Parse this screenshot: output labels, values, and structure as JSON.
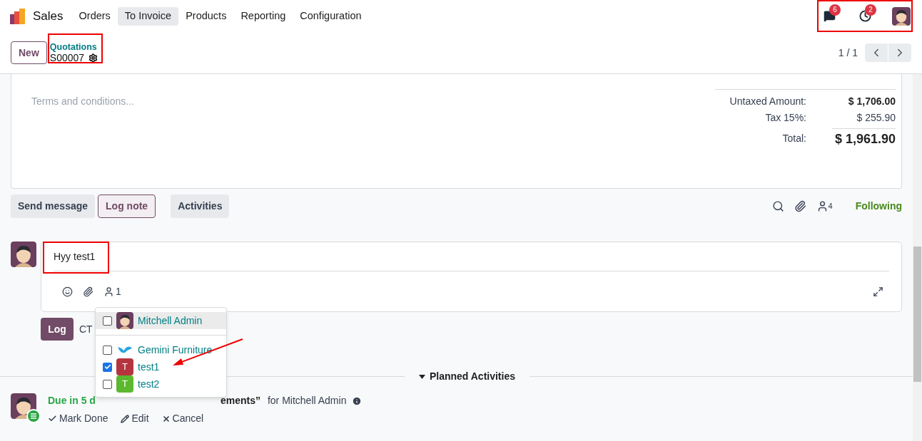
{
  "app": {
    "name": "Sales"
  },
  "menu": [
    {
      "label": "Orders",
      "selected": false
    },
    {
      "label": "To Invoice",
      "selected": true
    },
    {
      "label": "Products",
      "selected": false
    },
    {
      "label": "Reporting",
      "selected": false
    },
    {
      "label": "Configuration",
      "selected": false
    }
  ],
  "systray": {
    "messages_badge": "6",
    "activities_badge": "2"
  },
  "control_panel": {
    "new_button": "New",
    "breadcrumb": "Quotations",
    "record": "S00007",
    "pager": "1 / 1"
  },
  "form": {
    "terms_placeholder": "Terms and conditions...",
    "totals": [
      {
        "label": "Untaxed Amount:",
        "value": "$ 1,706.00",
        "kind": "bold"
      },
      {
        "label": "Tax 15%:",
        "value": "$ 255.90",
        "kind": "normal"
      },
      {
        "label": "Total:",
        "value": "$ 1,961.90",
        "kind": "total"
      }
    ]
  },
  "chatter": {
    "tabs": [
      {
        "label": "Send message",
        "selected": false
      },
      {
        "label": "Log note",
        "selected": true
      },
      {
        "label": "Activities",
        "selected": false
      }
    ],
    "followers_count": "4",
    "follow_label": "Following"
  },
  "composer": {
    "value": "Hyy test1",
    "recipients_count": "1",
    "log_button": "Log",
    "hint": "CT"
  },
  "recipients_dropdown": {
    "items": [
      {
        "name": "Mitchell Admin",
        "kind": "user",
        "checked": false,
        "highlighted": true
      },
      {
        "name": "Gemini Furniture",
        "kind": "company",
        "checked": false,
        "highlighted": false
      },
      {
        "name": "test1",
        "kind": "letter",
        "initial": "T",
        "color": "#b5353f",
        "checked": true,
        "highlighted": false
      },
      {
        "name": "test2",
        "kind": "letter",
        "initial": "T",
        "color": "#5cb82e",
        "checked": false,
        "highlighted": false
      }
    ]
  },
  "planned_activities": {
    "title": "Planned Activities",
    "expanded": true,
    "activity": {
      "due": "Due in 5 d",
      "summary": "ements”",
      "assignee": "for Mitchell Admin",
      "actions": [
        "Mark Done",
        "Edit",
        "Cancel"
      ]
    }
  }
}
